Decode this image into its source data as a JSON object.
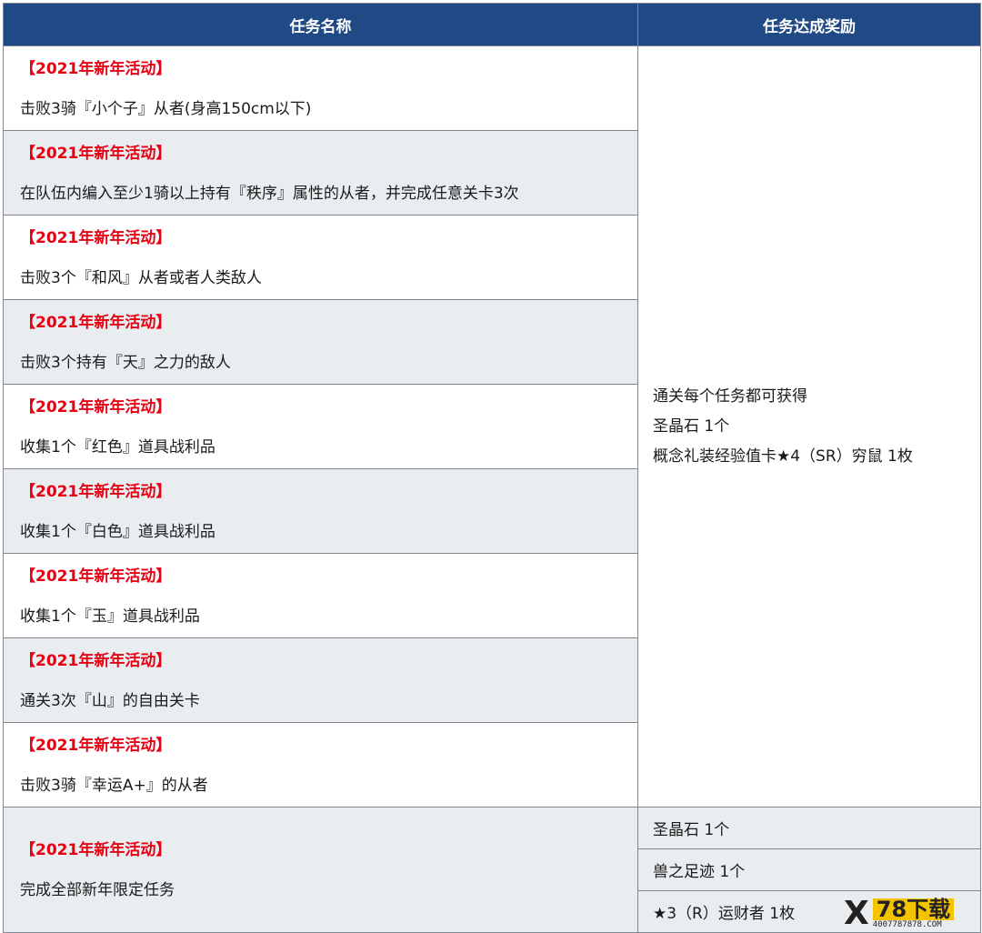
{
  "header": {
    "col1": "任务名称",
    "col2": "任务达成奖励"
  },
  "tasks": [
    {
      "tag": "【2021年新年活动】",
      "desc": "击败3骑『小个子』从者(身高150cm以下)"
    },
    {
      "tag": "【2021年新年活动】",
      "desc": "在队伍内编入至少1骑以上持有『秩序』属性的从者，并完成任意关卡3次"
    },
    {
      "tag": "【2021年新年活动】",
      "desc": "击败3个『和风』从者或者人类敌人"
    },
    {
      "tag": "【2021年新年活动】",
      "desc": "击败3个持有『天』之力的敌人"
    },
    {
      "tag": "【2021年新年活动】",
      "desc": "收集1个『红色』道具战利品"
    },
    {
      "tag": "【2021年新年活动】",
      "desc": "收集1个『白色』道具战利品"
    },
    {
      "tag": "【2021年新年活动】",
      "desc": "收集1个『玉』道具战利品"
    },
    {
      "tag": "【2021年新年活动】",
      "desc": "通关3次『山』的自由关卡"
    },
    {
      "tag": "【2021年新年活动】",
      "desc": "击败3骑『幸运A+』的从者"
    }
  ],
  "shared_reward": {
    "lines": [
      "通关每个任务都可获得",
      "圣晶石 1个",
      "概念礼装经验值卡★4（SR）穷鼠 1枚"
    ]
  },
  "final_task": {
    "tag": "【2021年新年活动】",
    "desc": "完成全部新年限定任务",
    "rewards": [
      "圣晶石 1个",
      "兽之足迹 1个",
      "★3（R）运财者 1枚"
    ]
  },
  "watermark": {
    "mark": "X",
    "title": "78下载",
    "site": "4007787878.COM"
  },
  "colors": {
    "header_bg": "#1f4a86",
    "tag_red": "#e60012",
    "alt_row": "#e9edf0"
  }
}
